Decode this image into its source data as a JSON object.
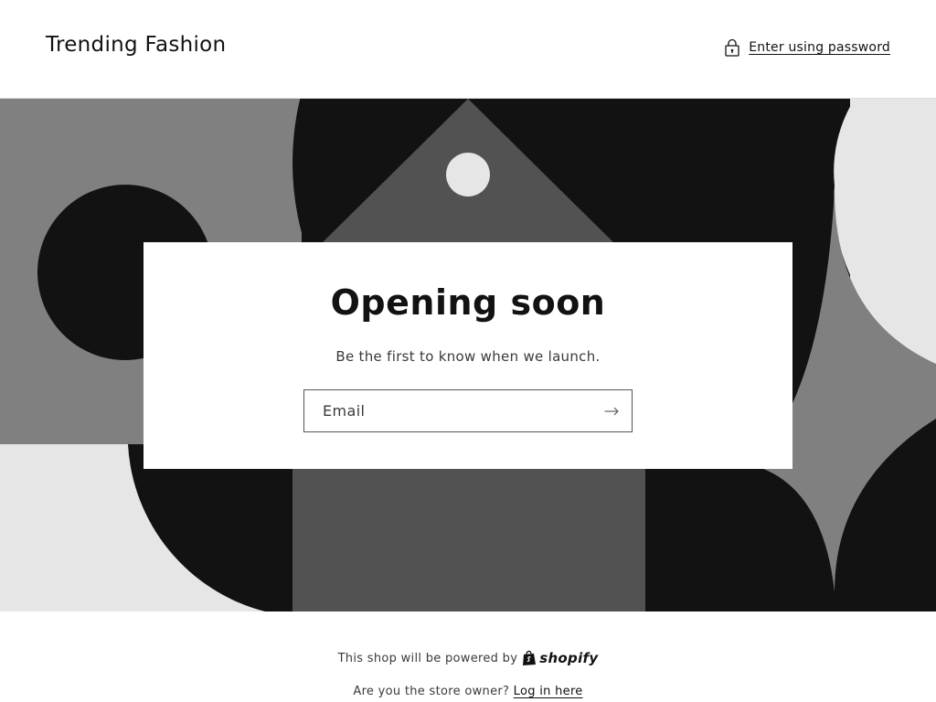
{
  "header": {
    "store_title": "Trending Fashion",
    "password_link_label": "Enter using password",
    "password_icon": "lock-icon"
  },
  "newsletter": {
    "heading": "Opening soon",
    "subheading": "Be the first to know when we launch.",
    "email_placeholder": "Email",
    "email_value": "",
    "submit_icon": "arrow-right-icon"
  },
  "footer": {
    "powered_by_text": "This shop will be powered by",
    "shopify_wordmark": "shopify",
    "owner_prompt": "Are you the store owner?",
    "login_link_label": "Log in here"
  },
  "colors": {
    "background": "#ffffff",
    "text": "#121212",
    "hero_dark": "#121212",
    "hero_mid": "#808080",
    "hero_dim": "#525252",
    "hero_light": "#e6e6e6"
  }
}
